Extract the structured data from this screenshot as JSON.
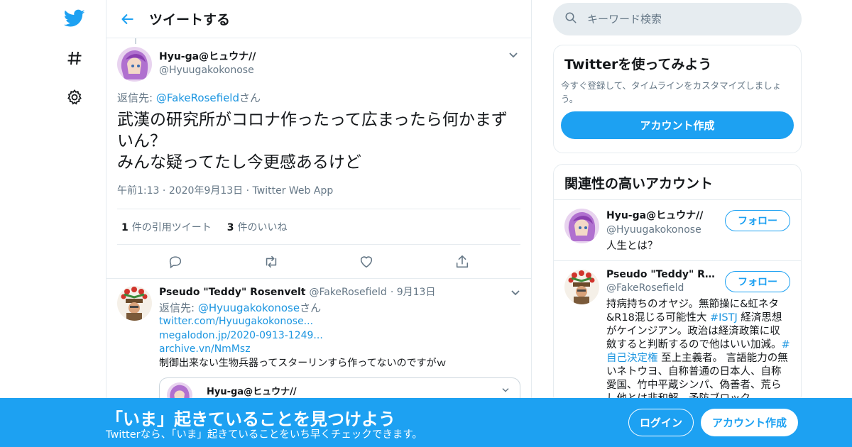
{
  "header": {
    "title": "ツイートする"
  },
  "tweet": {
    "author_name": "Hyu-ga@ヒュウナ//",
    "author_handle": "@Hyuugakokonose",
    "reply_prefix": "返信先: ",
    "reply_to": "@FakeRosefield",
    "reply_suffix": "さん",
    "text_line1": "武漢の研究所がコロナ作ったって広まったら何かまずいん？",
    "text_line2": "みんな疑ってたし今更感あるけど",
    "time": "午前1:13",
    "date": "2020年9月13日",
    "source": "Twitter Web App",
    "quote_count": "1",
    "quote_label": "件の引用ツイート",
    "like_count": "3",
    "like_label": "件のいいね"
  },
  "reply_tweet": {
    "author_name": "Pseudo \"Teddy\" Rosenvelt",
    "author_handle": "@FakeRosefield",
    "date": "9月13日",
    "reply_prefix": "返信先: ",
    "reply_to": "@Hyuugakokonose",
    "reply_suffix": "さん",
    "links": [
      "twitter.com/Hyuugakokonose...",
      "megalodon.jp/2020-0913-1249...",
      "archive.vn/NmMsz"
    ],
    "text": "制御出来ない生物兵器ってスターリンすら作ってないのですがｗ",
    "quoted_name": "Hyu-ga@ヒュウナ//"
  },
  "search": {
    "placeholder": "キーワード検索"
  },
  "signup_card": {
    "title": "Twitterを使ってみよう",
    "desc": "今すぐ登録して、タイムラインをカスタマイズしましょう。",
    "button": "アカウント作成"
  },
  "related": {
    "title": "関連性の高いアカウント",
    "accounts": [
      {
        "name": "Hyu-ga@ヒュウナ//",
        "handle": "@Hyuugakokonose",
        "follow": "フォロー",
        "bio": "人生とは？"
      },
      {
        "name": "Pseudo \"Teddy\" Rosenvelt",
        "handle": "@FakeRosefield",
        "follow": "フォロー",
        "bio_1": "持病持ちのオヤジ。無節操に&虹ネタ&R18混じる可能性大 ",
        "tag_1": "#ISTJ",
        "bio_2": " 経済思想がケインジアン。政治は経済政策に収斂すると判断するので他はいい加減。",
        "tag_2": "#自己決定権",
        "bio_3": " 至上主義者。 言語能力の無いネトウヨ、自称普通の日本人、自称愛国、竹中平蔵シンパ、偽善者、荒らし他とは非和解。予防ブロック"
      }
    ]
  },
  "banner": {
    "title": "「いま」起きていることを見つけよう",
    "sub": "Twitterなら、「いま」起きていることをいち早くチェックできます。",
    "login": "ログイン",
    "signup": "アカウント作成"
  },
  "colors": {
    "accent": "#1da1f2",
    "text": "#14171a",
    "muted": "#657786",
    "border": "#e6ecf0"
  }
}
